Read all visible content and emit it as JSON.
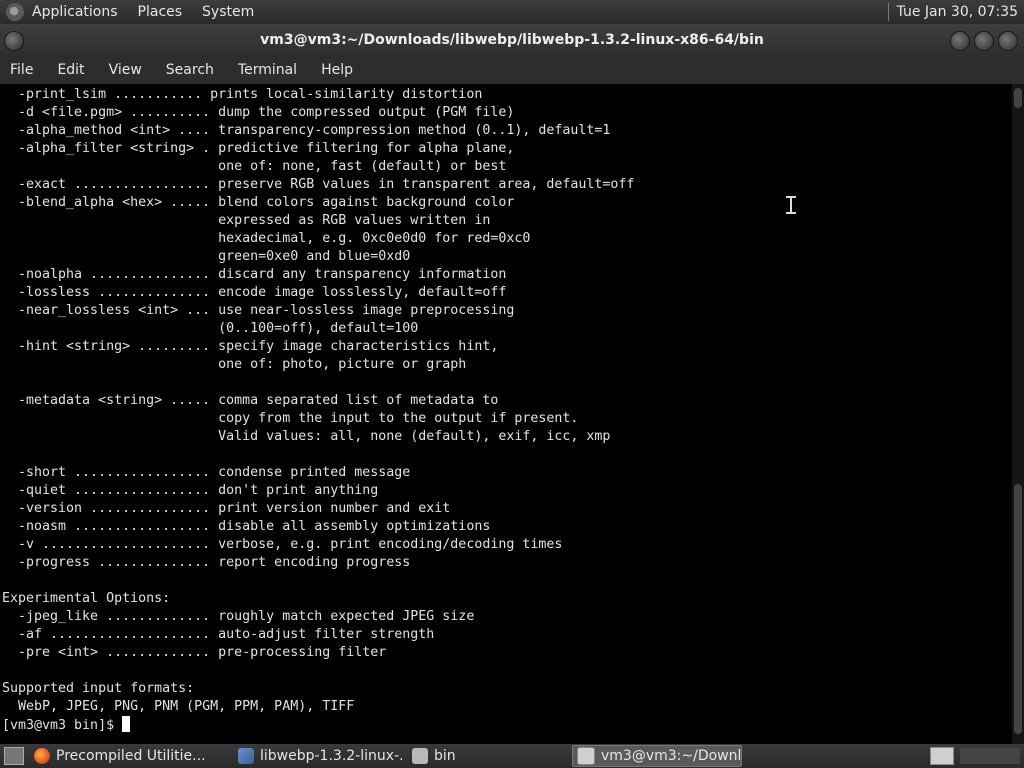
{
  "top_panel": {
    "menus": [
      "Applications",
      "Places",
      "System"
    ],
    "clock": "Tue Jan 30, 07:35"
  },
  "window": {
    "title": "vm3@vm3:~/Downloads/libwebp/libwebp-1.3.2-linux-x86-64/bin"
  },
  "menubar": [
    "File",
    "Edit",
    "View",
    "Search",
    "Terminal",
    "Help"
  ],
  "terminal": {
    "lines": [
      "  -print_lsim ........... prints local-similarity distortion",
      "  -d <file.pgm> .......... dump the compressed output (PGM file)",
      "  -alpha_method <int> .... transparency-compression method (0..1), default=1",
      "  -alpha_filter <string> . predictive filtering for alpha plane,",
      "                           one of: none, fast (default) or best",
      "  -exact ................. preserve RGB values in transparent area, default=off",
      "  -blend_alpha <hex> ..... blend colors against background color",
      "                           expressed as RGB values written in",
      "                           hexadecimal, e.g. 0xc0e0d0 for red=0xc0",
      "                           green=0xe0 and blue=0xd0",
      "  -noalpha ............... discard any transparency information",
      "  -lossless .............. encode image losslessly, default=off",
      "  -near_lossless <int> ... use near-lossless image preprocessing",
      "                           (0..100=off), default=100",
      "  -hint <string> ......... specify image characteristics hint,",
      "                           one of: photo, picture or graph",
      "",
      "  -metadata <string> ..... comma separated list of metadata to",
      "                           copy from the input to the output if present.",
      "                           Valid values: all, none (default), exif, icc, xmp",
      "",
      "  -short ................. condense printed message",
      "  -quiet ................. don't print anything",
      "  -version ............... print version number and exit",
      "  -noasm ................. disable all assembly optimizations",
      "  -v ..................... verbose, e.g. print encoding/decoding times",
      "  -progress .............. report encoding progress",
      "",
      "Experimental Options:",
      "  -jpeg_like ............. roughly match expected JPEG size",
      "  -af .................... auto-adjust filter strength",
      "  -pre <int> ............. pre-processing filter",
      "",
      "Supported input formats:",
      "  WebP, JPEG, PNG, PNM (PGM, PPM, PAM), TIFF"
    ],
    "prompt": "[vm3@vm3 bin]$ "
  },
  "taskbar": {
    "tasks": [
      {
        "label": "Precompiled Utilitie...",
        "icon": "firefox-icon"
      },
      {
        "label": "libwebp-1.3.2-linux-...",
        "icon": "file-manager-icon"
      },
      {
        "label": "bin",
        "icon": "folder-icon"
      },
      {
        "label": "vm3@vm3:~/Downl...",
        "icon": "terminal-icon",
        "active": true
      }
    ]
  }
}
